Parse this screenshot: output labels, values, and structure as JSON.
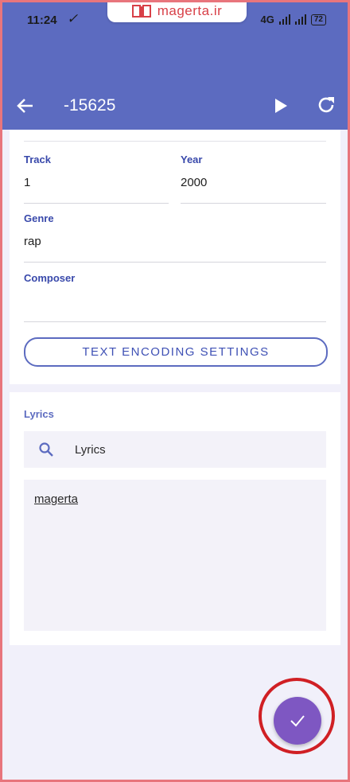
{
  "status_bar": {
    "time": "11:24",
    "network": "4G",
    "battery": "72"
  },
  "watermark": {
    "text": "magerta.ir"
  },
  "toolbar": {
    "title": "-15625"
  },
  "tags": {
    "track": {
      "label": "Track",
      "value": "1"
    },
    "year": {
      "label": "Year",
      "value": "2000"
    },
    "genre": {
      "label": "Genre",
      "value": "rap"
    },
    "composer": {
      "label": "Composer",
      "value": ""
    },
    "encoding_button": "TEXT ENCODING SETTINGS"
  },
  "lyrics": {
    "section_title": "Lyrics",
    "search_label": "Lyrics",
    "text": "magerta"
  },
  "colors": {
    "appbar": "#5c6bc0",
    "accent": "#3f51b5",
    "fab": "#7e57c2",
    "highlight": "#d01f24"
  },
  "icons": {
    "back": "arrow-left-icon",
    "play": "play-icon",
    "refresh": "refresh-icon",
    "search": "search-icon",
    "save": "check-icon"
  }
}
